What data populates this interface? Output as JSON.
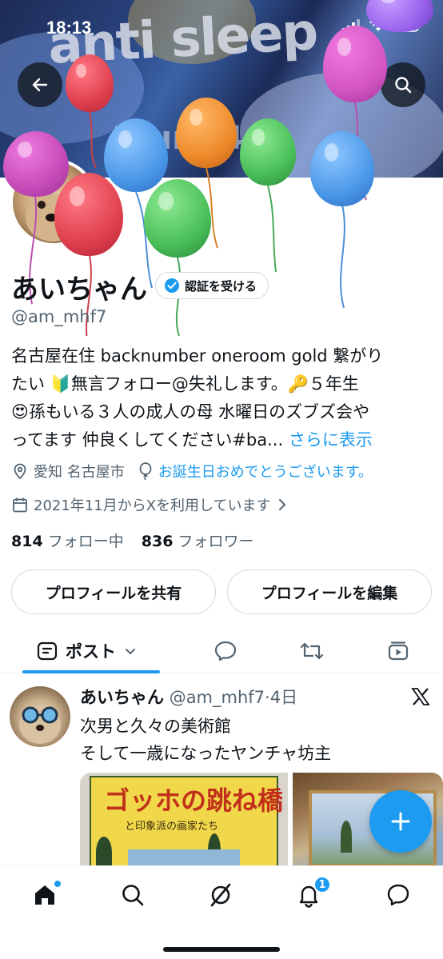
{
  "status_bar": {
    "time": "18:13"
  },
  "banner": {
    "text_main": "anti sleep",
    "text_sub": "tour 24"
  },
  "profile": {
    "name": "あいちゃん",
    "verify_label": "認証を受ける",
    "handle": "@am_mhf7",
    "bio_lines": [
      "名古屋在住 backnumber oneroom gold 繋がり",
      "たい 🔰無言フォロー@失礼します。🔑５年生",
      "😍孫もいる３人の成人の母 水曜日のズブズ会や",
      "ってます 仲良くしてください#ba..."
    ],
    "show_more": "さらに表示",
    "location": "愛知 名古屋市",
    "birthday": "お誕生日おめでとうございます。",
    "joined": "2021年11月からXを利用しています",
    "following_count": "814",
    "following_label": "フォロー中",
    "followers_count": "836",
    "followers_label": "フォロワー"
  },
  "buttons": {
    "share": "プロフィールを共有",
    "edit": "プロフィールを編集"
  },
  "tabs": {
    "posts": "ポスト"
  },
  "post": {
    "name": "あいちゃん",
    "meta": "@am_mhf7·4日",
    "line1": "次男と久々の美術館",
    "line2": "そして一歳になったヤンチャ坊主",
    "image1_title": "ゴッホの跳ね橋",
    "image1_subtitle": "と印象派の画家たち"
  },
  "nav": {
    "notification_badge": "1"
  },
  "colors": {
    "accent": "#1d9bf0",
    "text": "#0f1419",
    "muted": "#536471"
  }
}
